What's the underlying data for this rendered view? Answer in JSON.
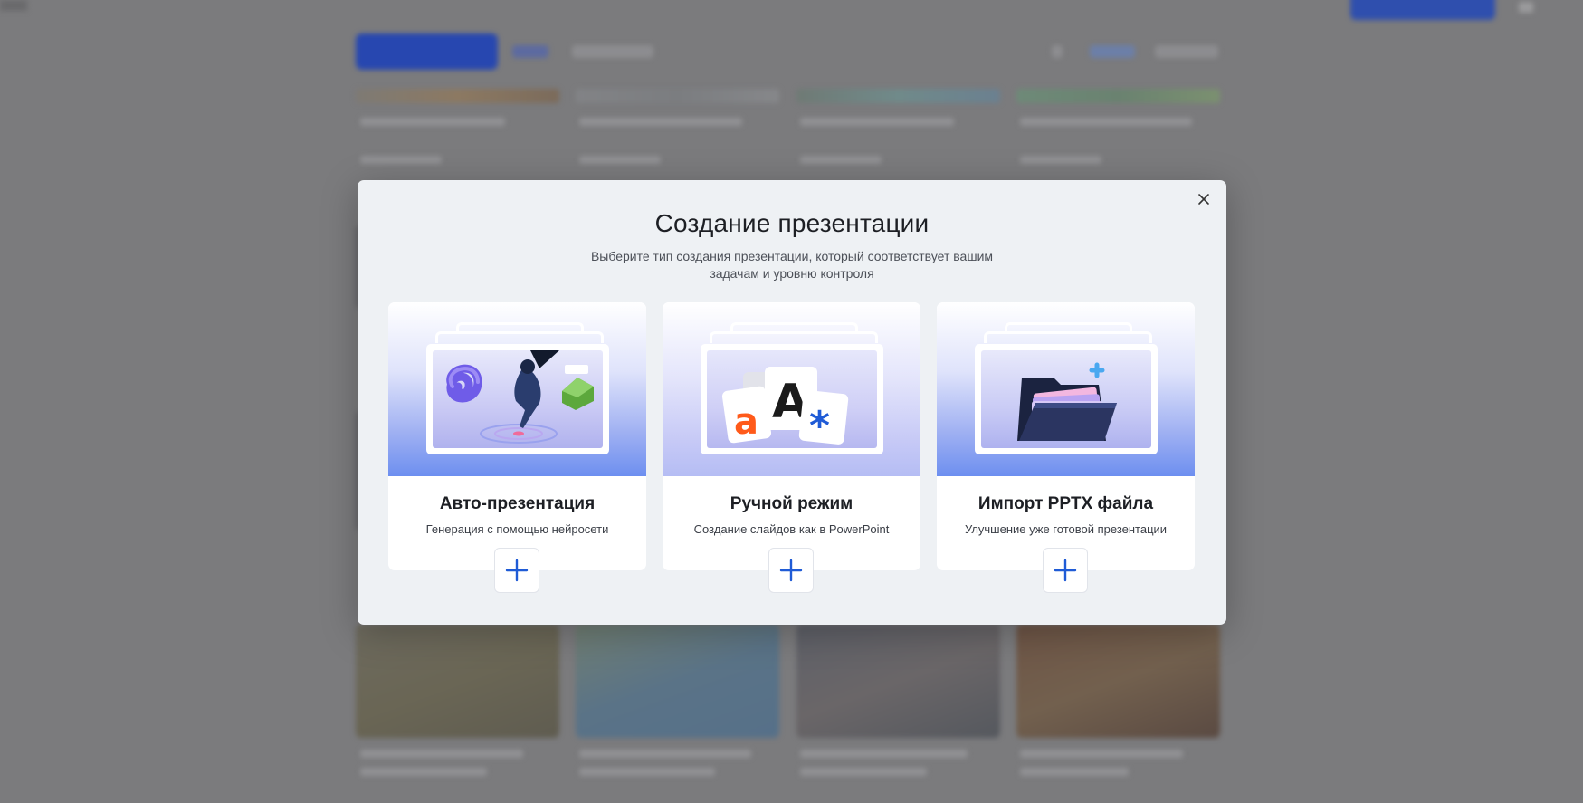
{
  "modal": {
    "title": "Создание презентации",
    "subtitle": "Выберите тип создания презентации, который соответствует вашим задачам и уровню контроля",
    "close_icon": "close-icon"
  },
  "options": [
    {
      "name": "Авто-презентация",
      "description": "Генерация с помощью нейросети",
      "action_icon": "plus-icon",
      "illustration": "ai-figure-illustration"
    },
    {
      "name": "Ручной режим",
      "description": "Создание слайдов как в PowerPoint",
      "action_icon": "plus-icon",
      "illustration": "letters-illustration",
      "letters": [
        "a",
        "A",
        "*"
      ]
    },
    {
      "name": "Импорт PPTX файла",
      "description": "Улучшение уже готовой презентации",
      "action_icon": "plus-icon",
      "illustration": "folder-illustration"
    }
  ],
  "colors": {
    "accent": "#1f5bd6",
    "overlay": "#7b7b7d",
    "modal_bg": "#eef1f4"
  }
}
